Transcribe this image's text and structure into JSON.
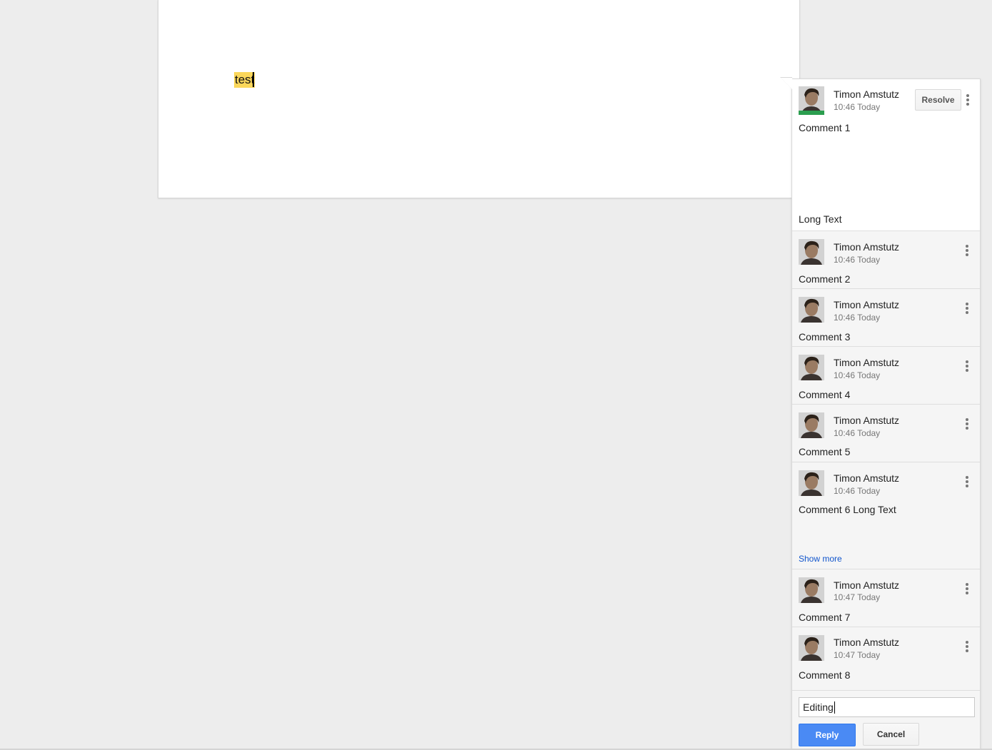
{
  "document": {
    "text": "test"
  },
  "comments": [
    {
      "author": "Timon Amstutz",
      "time": "10:46 Today",
      "text": "Comment 1",
      "extra_text": "Long Text",
      "resolve_label": "Resolve"
    },
    {
      "author": "Timon Amstutz",
      "time": "10:46 Today",
      "text": "Comment 2"
    },
    {
      "author": "Timon Amstutz",
      "time": "10:46 Today",
      "text": "Comment 3"
    },
    {
      "author": "Timon Amstutz",
      "time": "10:46 Today",
      "text": "Comment 4"
    },
    {
      "author": "Timon Amstutz",
      "time": "10:46 Today",
      "text": "Comment 5"
    },
    {
      "author": "Timon Amstutz",
      "time": "10:46 Today",
      "text": "Comment 6 Long Text",
      "show_more": "Show more"
    },
    {
      "author": "Timon Amstutz",
      "time": "10:47 Today",
      "text": "Comment 7"
    },
    {
      "author": "Timon Amstutz",
      "time": "10:47 Today",
      "text": "Comment 8"
    }
  ],
  "reply": {
    "value": "Editing",
    "reply_label": "Reply",
    "cancel_label": "Cancel"
  },
  "colors": {
    "highlight": "#fbd75b",
    "reply_button": "#4a8af4",
    "link": "#1155cc",
    "presence_bar": "#2b9e4f"
  }
}
